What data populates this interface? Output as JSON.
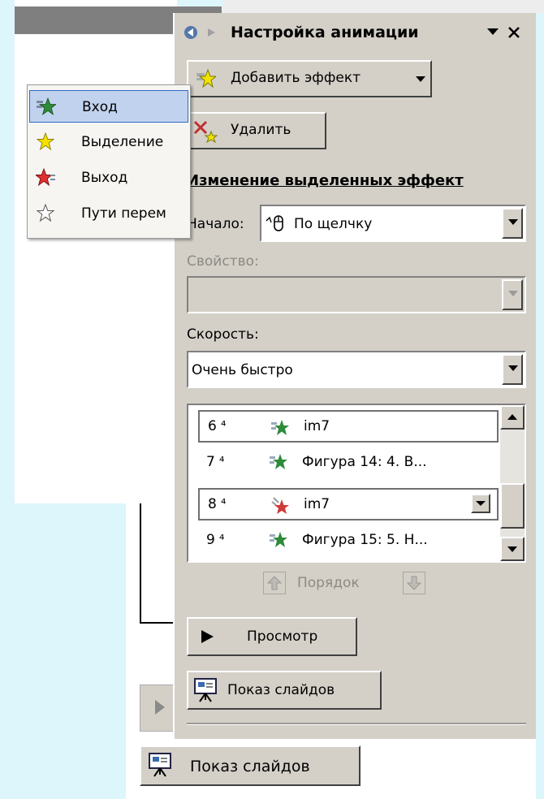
{
  "pane": {
    "title": "Настройка анимации",
    "add_effect_label": "Добавить эффект",
    "remove_label": "Удалить",
    "section_heading": "Изменение выделенных эффект",
    "start_label": "Начало:",
    "start_value": "По щелчку",
    "property_label": "Свойство:",
    "property_value": "",
    "speed_label": "Скорость:",
    "speed_value": "Очень быстро",
    "order_label": "Порядок",
    "preview_label": "Просмотр",
    "slideshow_label": "Показ слайдов"
  },
  "menu": {
    "items": [
      {
        "label": "Вход",
        "icon": "entrance-star-icon",
        "color": "#2e8b3a"
      },
      {
        "label": "Выделение",
        "icon": "emphasis-star-icon",
        "color": "#f5e000"
      },
      {
        "label": "Выход",
        "icon": "exit-star-icon",
        "color": "#e03030"
      },
      {
        "label": "Пути перем",
        "icon": "motion-path-star-icon",
        "color": "#ffffff"
      }
    ]
  },
  "effects_list": {
    "rows": [
      {
        "number": "6",
        "name": "im7",
        "effect": "entrance"
      },
      {
        "number": "7",
        "name": "Фигура 14: 4. В...",
        "effect": "entrance"
      },
      {
        "number": "8",
        "name": "im7",
        "effect": "exit"
      },
      {
        "number": "9",
        "name": "Фигура 15: 5. Н...",
        "effect": "entrance"
      }
    ]
  },
  "bottom": {
    "slideshow_label": "Показ слайдов"
  }
}
